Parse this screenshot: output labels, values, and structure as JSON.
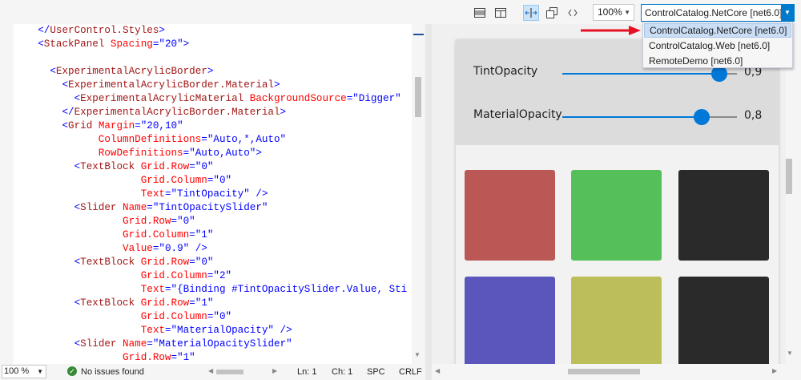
{
  "toolbar": {
    "zoom": "100%",
    "target": "ControlCatalog.NetCore [net6.0]",
    "icons": [
      "split-horizontal-icon",
      "split-vertical-icon",
      "swap-panes-icon",
      "popout-icon",
      "xml-code-icon"
    ]
  },
  "target_options": [
    "ControlCatalog.NetCore [net6.0]",
    "ControlCatalog.Web [net6.0]",
    "RemoteDemo [net6.0]"
  ],
  "code_lines": [
    [
      [
        "p",
        "    </"
      ],
      [
        "t",
        "UserControl.Styles"
      ],
      [
        "p",
        ">"
      ]
    ],
    [
      [
        "p",
        "    <"
      ],
      [
        "t",
        "StackPanel"
      ],
      [
        "a",
        " Spacing"
      ],
      [
        "p",
        "="
      ],
      [
        "v",
        "\"20\""
      ],
      [
        "p",
        ">"
      ]
    ],
    [],
    [
      [
        "p",
        "      <"
      ],
      [
        "t",
        "ExperimentalAcrylicBorder"
      ],
      [
        "p",
        ">"
      ]
    ],
    [
      [
        "p",
        "        <"
      ],
      [
        "t",
        "ExperimentalAcrylicBorder.Material"
      ],
      [
        "p",
        ">"
      ]
    ],
    [
      [
        "p",
        "          <"
      ],
      [
        "t",
        "ExperimentalAcrylicMaterial"
      ],
      [
        "a",
        " BackgroundSource"
      ],
      [
        "p",
        "="
      ],
      [
        "v",
        "\"Digger\""
      ]
    ],
    [
      [
        "p",
        "        </"
      ],
      [
        "t",
        "ExperimentalAcrylicBorder.Material"
      ],
      [
        "p",
        ">"
      ]
    ],
    [
      [
        "p",
        "        <"
      ],
      [
        "t",
        "Grid"
      ],
      [
        "a",
        " Margin"
      ],
      [
        "p",
        "="
      ],
      [
        "v",
        "\"20,10\""
      ]
    ],
    [
      [
        "a",
        "              ColumnDefinitions"
      ],
      [
        "p",
        "="
      ],
      [
        "v",
        "\"Auto,*,Auto\""
      ]
    ],
    [
      [
        "a",
        "              RowDefinitions"
      ],
      [
        "p",
        "="
      ],
      [
        "v",
        "\"Auto,Auto\""
      ],
      [
        "p",
        ">"
      ]
    ],
    [
      [
        "p",
        "          <"
      ],
      [
        "t",
        "TextBlock"
      ],
      [
        "a",
        " Grid.Row"
      ],
      [
        "p",
        "="
      ],
      [
        "v",
        "\"0\""
      ]
    ],
    [
      [
        "a",
        "                     Grid.Column"
      ],
      [
        "p",
        "="
      ],
      [
        "v",
        "\"0\""
      ]
    ],
    [
      [
        "a",
        "                     Text"
      ],
      [
        "p",
        "="
      ],
      [
        "v",
        "\"TintOpacity\""
      ],
      [
        "p",
        " />"
      ]
    ],
    [
      [
        "p",
        "          <"
      ],
      [
        "t",
        "Slider"
      ],
      [
        "a",
        " Name"
      ],
      [
        "p",
        "="
      ],
      [
        "v",
        "\"TintOpacitySlider\""
      ]
    ],
    [
      [
        "a",
        "                  Grid.Row"
      ],
      [
        "p",
        "="
      ],
      [
        "v",
        "\"0\""
      ]
    ],
    [
      [
        "a",
        "                  Grid.Column"
      ],
      [
        "p",
        "="
      ],
      [
        "v",
        "\"1\""
      ]
    ],
    [
      [
        "a",
        "                  Value"
      ],
      [
        "p",
        "="
      ],
      [
        "v",
        "\"0.9\""
      ],
      [
        "p",
        " />"
      ]
    ],
    [
      [
        "p",
        "          <"
      ],
      [
        "t",
        "TextBlock"
      ],
      [
        "a",
        " Grid.Row"
      ],
      [
        "p",
        "="
      ],
      [
        "v",
        "\"0\""
      ]
    ],
    [
      [
        "a",
        "                     Grid.Column"
      ],
      [
        "p",
        "="
      ],
      [
        "v",
        "\"2\""
      ]
    ],
    [
      [
        "a",
        "                     Text"
      ],
      [
        "p",
        "="
      ],
      [
        "v",
        "\"{Binding #TintOpacitySlider.Value, Sti"
      ]
    ],
    [
      [
        "p",
        "          <"
      ],
      [
        "t",
        "TextBlock"
      ],
      [
        "a",
        " Grid.Row"
      ],
      [
        "p",
        "="
      ],
      [
        "v",
        "\"1\""
      ]
    ],
    [
      [
        "a",
        "                     Grid.Column"
      ],
      [
        "p",
        "="
      ],
      [
        "v",
        "\"0\""
      ]
    ],
    [
      [
        "a",
        "                     Text"
      ],
      [
        "p",
        "="
      ],
      [
        "v",
        "\"MaterialOpacity\""
      ],
      [
        "p",
        " />"
      ]
    ],
    [
      [
        "p",
        "          <"
      ],
      [
        "t",
        "Slider"
      ],
      [
        "a",
        " Name"
      ],
      [
        "p",
        "="
      ],
      [
        "v",
        "\"MaterialOpacitySlider\""
      ]
    ],
    [
      [
        "a",
        "                  Grid.Row"
      ],
      [
        "p",
        "="
      ],
      [
        "v",
        "\"1\""
      ]
    ]
  ],
  "status": {
    "zoom": "100 %",
    "issues": "No issues found",
    "line": "Ln: 1",
    "col": "Ch: 1",
    "spc": "SPC",
    "eol": "CRLF"
  },
  "preview": {
    "sliders": [
      {
        "label": "TintOpacity",
        "value_text": "0,9",
        "value": 0.9
      },
      {
        "label": "MaterialOpacity",
        "value_text": "0,8",
        "value": 0.8
      }
    ],
    "swatches": [
      "#bb5755",
      "#55bf59",
      "#2a2a2a",
      "#5a56bb",
      "#bcbe5a",
      "#2a2a2a"
    ],
    "accent": "#0078d7"
  },
  "colors": {
    "accent": "#007acc",
    "arrow": "#e81123"
  }
}
